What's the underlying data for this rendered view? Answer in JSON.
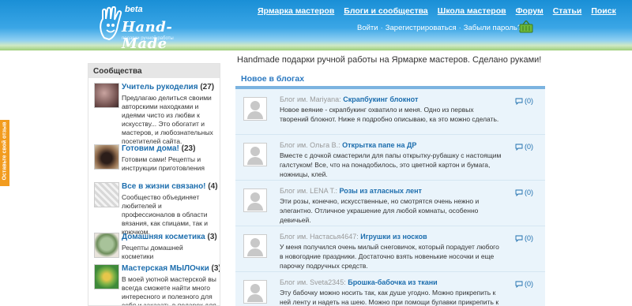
{
  "header": {
    "logo": {
      "beta": "beta",
      "name": "Hand-Made",
      "sub": "подарки ручной работы"
    },
    "nav": [
      "Ярмарка мастеров",
      "Блоги и сообщества",
      "Школа мастеров",
      "Форум",
      "Статьи",
      "Поиск"
    ],
    "auth": {
      "login": "Войти",
      "register": "Зарегистрироваться",
      "forgot": "Забыли пароль?",
      "separator": "·"
    }
  },
  "feedback": {
    "label": "Оставьте свой отзыв"
  },
  "sidebar": {
    "title": "Сообщества",
    "items": [
      {
        "title": "Учитель рукоделия",
        "count": "(27)",
        "desc": "Предлагаю делиться своими авторскими находками и идеями чисто из любви к искусству... Это обогатит и мастеров, и любознательных посетителей сайта."
      },
      {
        "title": "Готовим дома!",
        "count": "(23)",
        "desc": "Готовим сами! Рецепты и инструкции приготовления"
      },
      {
        "title": "Все в жизни связано!",
        "count": "(4)",
        "desc": "Сообщество объединяет любителей и профессионалов в области вязания, как спицами, так и крючком."
      },
      {
        "title": "Домашняя косметика",
        "count": "(3)",
        "desc": "Рецепты домашней косметики"
      },
      {
        "title": "Мастерская МЫЛОчки",
        "count": "(3)",
        "desc": "В моей уютной мастерской вы всегда сможете найти много интересного и полезного для себя и заказать в подарок для"
      }
    ]
  },
  "main": {
    "tagline": "Handmade подарки ручной работы на Ярмарке мастеров. Сделано руками!",
    "blog_heading": "Новое в блогах",
    "posts": [
      {
        "blog": "Блог им. Mariyana:",
        "title": "Скрапбукинг блокнот",
        "text": "Новое веяние - скрапбукинг охватило и меня. Одно из первых творений блокнот. Ниже я подробно описываю, ка это можно сделать.",
        "comments": "(0)"
      },
      {
        "blog": "Блог им. Ольга В.:",
        "title": "Открытка папе на ДР",
        "text": "Вместе с дочкой смастерили для папы открытку-рубашку с настоящим галстуком! Все, что на понадобилось, это цветной картон и бумага, ножницы, клей.",
        "comments": "(0)"
      },
      {
        "blog": "Блог им. LENA T.:",
        "title": "Розы из атласных лент",
        "text": "Эти розы, конечно, искусственные, но смотрятся очень нежно и элегантно. Отличное украшение для любой комнаты, особенно девичьей.",
        "comments": "(0)"
      },
      {
        "blog": "Блог им. Настасья4647:",
        "title": "Игрушки из носков",
        "text": "У меня получился очень милый снеговичок, который порадует любого в новогодние праздники. Достаточно взять новенькие носочки и еще парочку подручных средств.",
        "comments": "(0)"
      },
      {
        "blog": "Блог им. Sveta2345:",
        "title": "Брошка-бабочка из ткани",
        "text": "Эту бабочку можно носить так, как душе угодно. Можно прикрепить к ней ленту и надеть на шею. Можно при помощи булавки прикрепить к блузке или",
        "comments": "(0)"
      }
    ]
  },
  "colors": {
    "header_blue": "#1a8fd6",
    "link_blue": "#1d6eae",
    "feedback_orange": "#f29c1f",
    "blog_bg": "#eaf4fb"
  }
}
